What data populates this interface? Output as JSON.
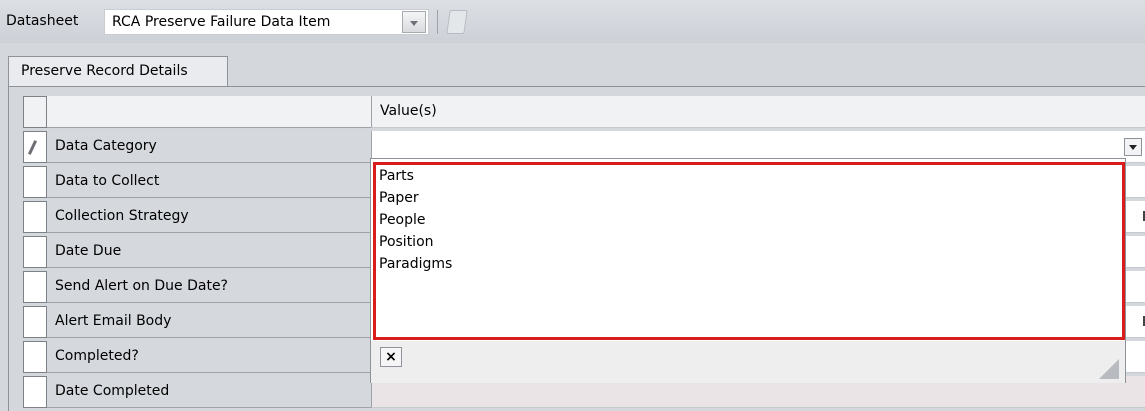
{
  "toolbar": {
    "datasheet_label": "Datasheet",
    "datasheet_value": "RCA Preserve Failure Data Item"
  },
  "tabs": [
    {
      "label": "Preserve Record Details",
      "active": true
    }
  ],
  "grid": {
    "value_header": "Value(s)",
    "rows": [
      {
        "label": "Data Category"
      },
      {
        "label": "Data to Collect"
      },
      {
        "label": "Collection Strategy"
      },
      {
        "label": "Date Due"
      },
      {
        "label": "Send Alert on Due Date?"
      },
      {
        "label": "Alert Email Body"
      },
      {
        "label": "Completed?"
      },
      {
        "label": "Date Completed"
      }
    ]
  },
  "dropdown": {
    "options": [
      "Parts",
      "Paper",
      "People",
      "Position",
      "Paradigms"
    ],
    "clear_button": "×",
    "highlight_color": "#d91c1c"
  }
}
